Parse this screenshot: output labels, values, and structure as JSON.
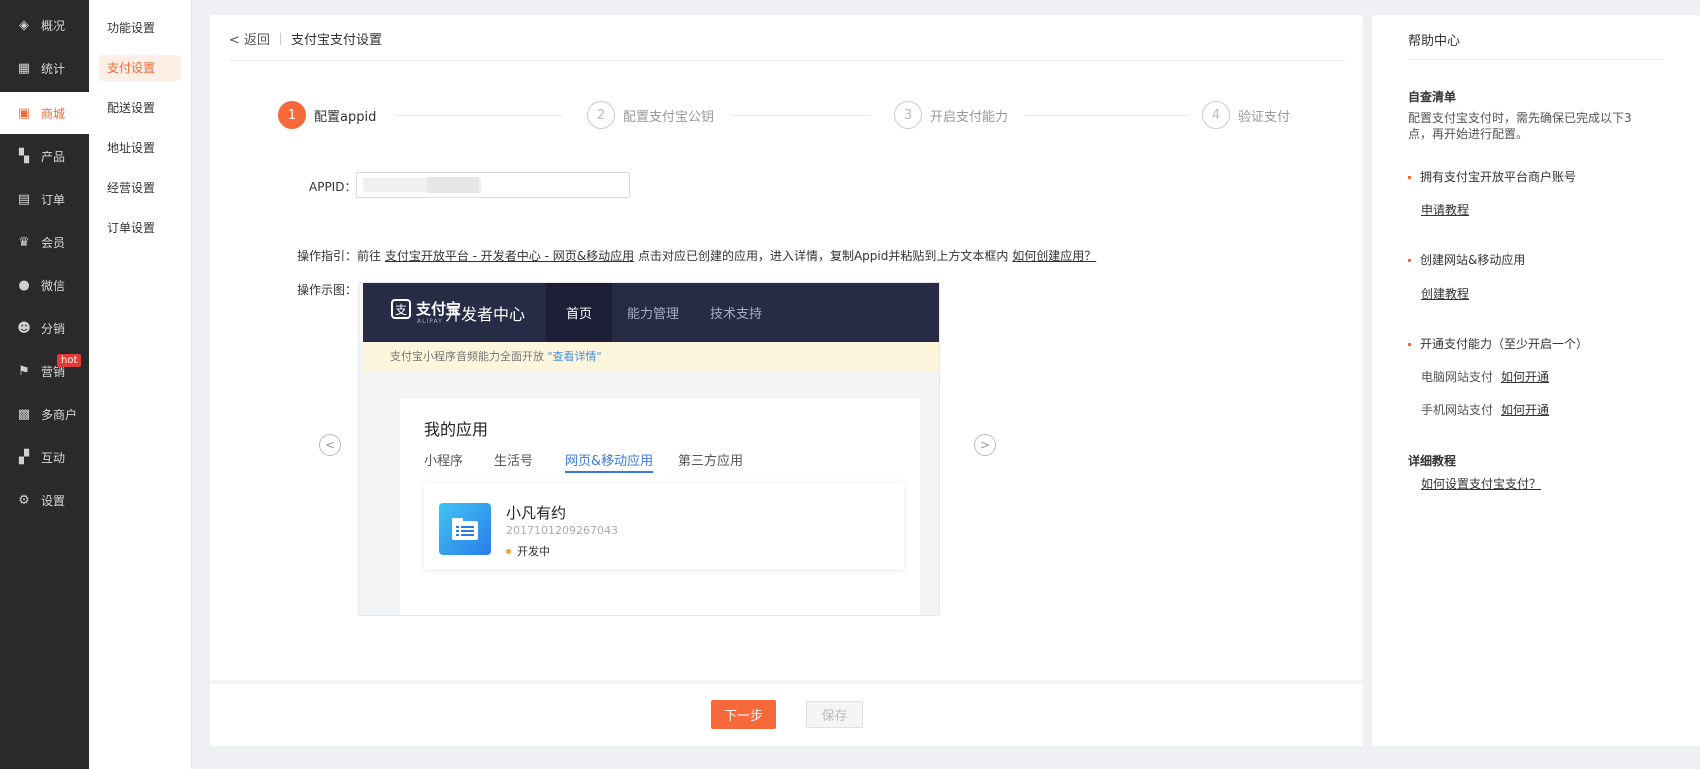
{
  "nav_primary": [
    {
      "label": "概况",
      "icon": "layers-icon",
      "glyph": "◈"
    },
    {
      "label": "统计",
      "icon": "chart-icon",
      "glyph": "▦"
    },
    {
      "label": "商城",
      "icon": "shop-icon",
      "glyph": "▣",
      "active": true
    },
    {
      "label": "产品",
      "icon": "grid-icon",
      "glyph": "▚"
    },
    {
      "label": "订单",
      "icon": "order-icon",
      "glyph": "▤"
    },
    {
      "label": "会员",
      "icon": "crown-icon",
      "glyph": "♛"
    },
    {
      "label": "微信",
      "icon": "wechat-icon",
      "glyph": "●"
    },
    {
      "label": "分销",
      "icon": "user-share-icon",
      "glyph": "☻"
    },
    {
      "label": "营销",
      "icon": "flag-icon",
      "glyph": "⚑",
      "badge": "hot"
    },
    {
      "label": "多商户",
      "icon": "store-icon",
      "glyph": "▩"
    },
    {
      "label": "互动",
      "icon": "interact-icon",
      "glyph": "▞"
    },
    {
      "label": "设置",
      "icon": "gear-icon",
      "glyph": "⚙"
    }
  ],
  "nav_secondary": [
    {
      "label": "功能设置"
    },
    {
      "label": "支付设置",
      "active": true
    },
    {
      "label": "配送设置"
    },
    {
      "label": "地址设置"
    },
    {
      "label": "经营设置"
    },
    {
      "label": "订单设置"
    }
  ],
  "breadcrumb": {
    "back": "< 返回",
    "current": "支付宝支付设置"
  },
  "steps": [
    {
      "num": "1",
      "label": "配置appid",
      "done": true
    },
    {
      "num": "2",
      "label": "配置支付宝公钥"
    },
    {
      "num": "3",
      "label": "开启支付能力"
    },
    {
      "num": "4",
      "label": "验证支付"
    }
  ],
  "form": {
    "appid_label": "APPID：",
    "appid_value": ""
  },
  "guide": {
    "prefix": "操作指引：前往",
    "link1": "支付宝开放平台 - 开发者中心 - 网页&移动应用",
    "middle": "点击对应已创建的应用，进入详情，复制Appid并粘贴到上方文本框内",
    "link2": "如何创建应用？",
    "demo_label": "操作示图："
  },
  "demo": {
    "logo_glyph": "支",
    "brand": "支付宝",
    "brand_sub": "ALIPAY",
    "dev_center": "开发者中心",
    "menu": [
      "首页",
      "能力管理",
      "技术支持"
    ],
    "notice": "支付宝小程序音频能力全面开放",
    "notice_link": "\"查看详情\"",
    "panel_title": "我的应用",
    "tabs": [
      "小程序",
      "生活号",
      "网页&移动应用",
      "第三方应用"
    ],
    "app_name": "小凡有约",
    "app_id": "2017101209267043",
    "app_status": "开发中"
  },
  "buttons": {
    "next": "下一步",
    "save": "保存"
  },
  "help": {
    "title": "帮助中心",
    "checklist_title": "自查清单",
    "checklist_desc": "配置支付宝支付时，需先确保已完成以下3点，再开始进行配置。",
    "item1": "拥有支付宝开放平台商户账号",
    "item1_link": "申请教程",
    "item2": "创建网站&移动应用",
    "item2_link": "创建教程",
    "item3": "开通支付能力（至少开启一个）",
    "pc_pay": "电脑网站支付",
    "mobile_pay": "手机网站支付",
    "how_open": "如何开通",
    "detail_title": "详细教程",
    "detail_link": "如何设置支付宝支付？"
  },
  "colors": {
    "accent": "#f7693a",
    "sidebar_bg": "#2a2a2a",
    "link_blue": "#3a7bd5"
  }
}
